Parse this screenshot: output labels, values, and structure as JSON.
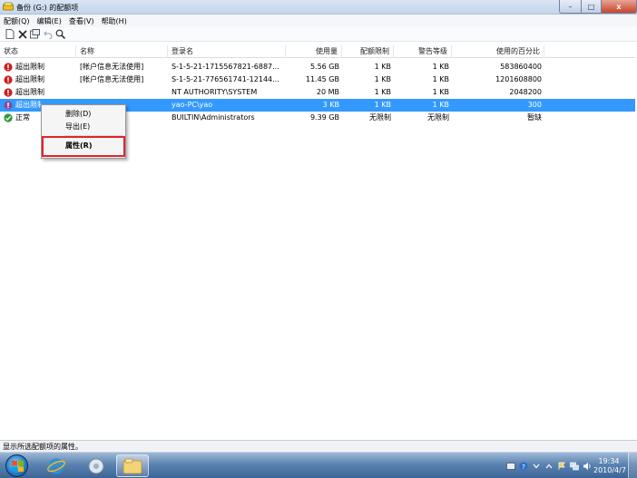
{
  "window": {
    "title": "备份 (G:) 的配额项",
    "buttons": {
      "minimize": "–",
      "maximize": "□",
      "close": "x"
    }
  },
  "menu": [
    "配额(Q)",
    "编辑(E)",
    "查看(V)",
    "帮助(H)"
  ],
  "columns": [
    "状态",
    "名称",
    "登录名",
    "使用量",
    "配额限制",
    "警告等级",
    "使用的百分比"
  ],
  "rows": [
    {
      "status": "超出限制",
      "status_icon": "error-icon",
      "name": "[帐户信息无法使用]",
      "login": "S-1-5-21-1715567821-6887...",
      "used": "5.56 GB",
      "limit": "1 KB",
      "warning": "1 KB",
      "percent": "583860400"
    },
    {
      "status": "超出限制",
      "status_icon": "error-icon",
      "name": "[帐户信息无法使用]",
      "login": "S-1-5-21-776561741-12144...",
      "used": "11.45 GB",
      "limit": "1 KB",
      "warning": "1 KB",
      "percent": "1201608800"
    },
    {
      "status": "超出限制",
      "status_icon": "error-icon",
      "name": "",
      "login": "NT AUTHORITY\\SYSTEM",
      "used": "20 MB",
      "limit": "1 KB",
      "warning": "1 KB",
      "percent": "2048200"
    },
    {
      "status": "超出限制",
      "status_icon": "error-icon",
      "name": "",
      "login": "yao-PC\\yao",
      "used": "3 KB",
      "limit": "1 KB",
      "warning": "1 KB",
      "percent": "300",
      "selected": true
    },
    {
      "status": "正常",
      "status_icon": "ok-icon",
      "name": "",
      "login": "BUILTIN\\Administrators",
      "used": "9.39 GB",
      "limit": "无限制",
      "warning": "无限制",
      "percent": "暂缺"
    }
  ],
  "context_menu": {
    "delete": "删除(D)",
    "export": "导出(E)",
    "properties": "属性(R)"
  },
  "statusbar": {
    "text": "显示所选配额项的属性。"
  },
  "taskbar": {
    "time": "19:34",
    "date": "2010/4/7"
  },
  "colors": {
    "selection": "#3399ff",
    "highlight_box": "#e0242c",
    "error": "#c8211e",
    "ok": "#2a9a3a"
  }
}
